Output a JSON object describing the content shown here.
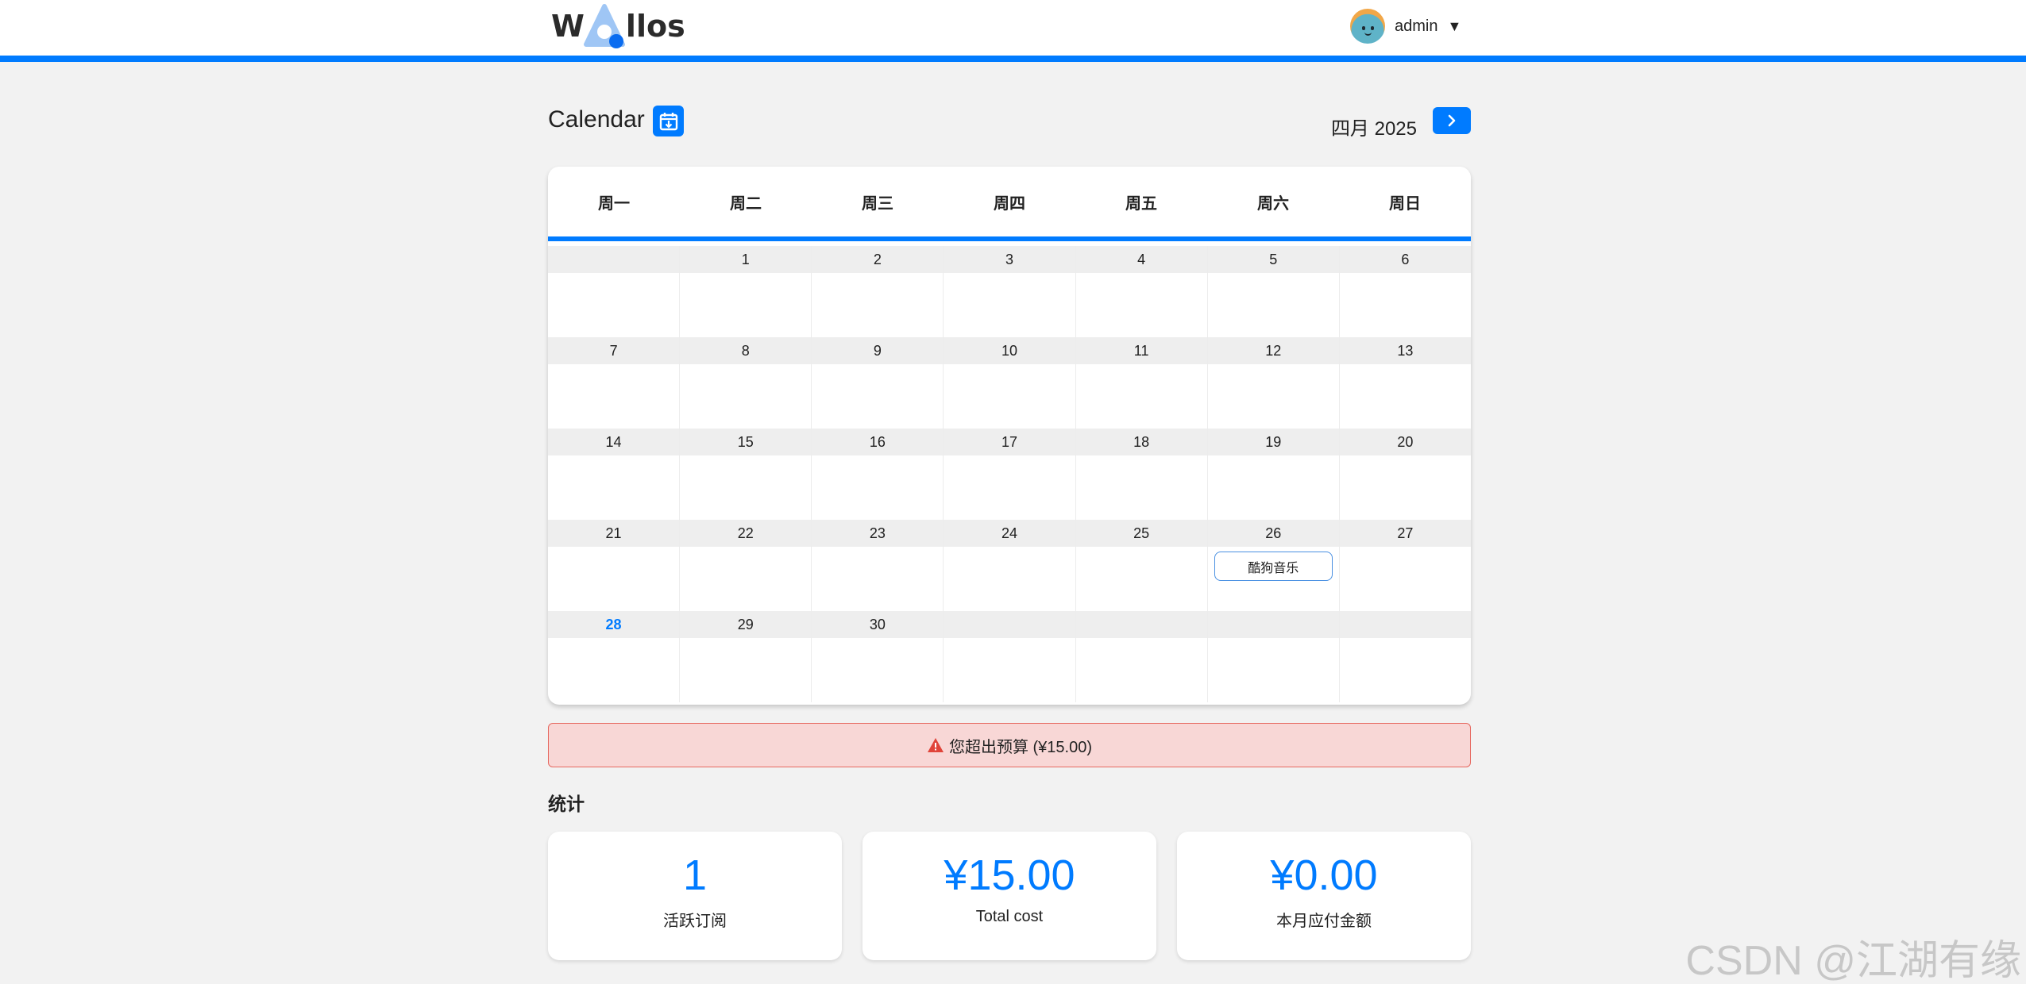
{
  "header": {
    "logo_first": "W",
    "logo_rest": "llos",
    "user_name": "admin",
    "user_caret": "▼"
  },
  "calendar": {
    "title": "Calendar",
    "month_label": "四月 2025",
    "weekdays": [
      "周一",
      "周二",
      "周三",
      "周四",
      "周五",
      "周六",
      "周日"
    ],
    "weeks": [
      [
        "",
        "1",
        "2",
        "3",
        "4",
        "5",
        "6"
      ],
      [
        "7",
        "8",
        "9",
        "10",
        "11",
        "12",
        "13"
      ],
      [
        "14",
        "15",
        "16",
        "17",
        "18",
        "19",
        "20"
      ],
      [
        "21",
        "22",
        "23",
        "24",
        "25",
        "26",
        "27"
      ],
      [
        "28",
        "29",
        "30",
        "",
        "",
        "",
        ""
      ]
    ],
    "today": "28",
    "events": [
      {
        "day": "26",
        "label": "酷狗音乐"
      }
    ]
  },
  "alert": {
    "icon": "warning-icon",
    "text": "您超出预算 (¥15.00)"
  },
  "stats": {
    "title": "统计",
    "cards": [
      {
        "value": "1",
        "label": "活跃订阅"
      },
      {
        "value": "¥15.00",
        "label": "Total cost"
      },
      {
        "value": "¥0.00",
        "label": "本月应付金额"
      }
    ]
  },
  "watermark": "CSDN @江湖有缘",
  "colors": {
    "accent": "#007bff",
    "alert_bg": "#f8d7d6",
    "alert_border": "#e6685f",
    "background": "#f2f2f2"
  }
}
